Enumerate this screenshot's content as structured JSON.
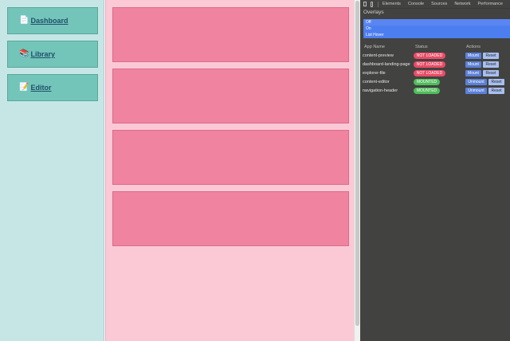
{
  "sidebar": {
    "items": [
      {
        "icon": "📄",
        "icon_name": "document-icon",
        "label": "Dashboard"
      },
      {
        "icon": "📚",
        "icon_name": "books-icon",
        "label": "Library"
      },
      {
        "icon": "📝",
        "icon_name": "memo-icon",
        "label": "Editor"
      }
    ]
  },
  "devtools": {
    "tabs": [
      "Elements",
      "Console",
      "Sources",
      "Network",
      "Performance"
    ],
    "overlays": {
      "title": "Overlays",
      "options": [
        "Off",
        "On",
        "List Hover"
      ],
      "selected": "Off"
    },
    "columns": {
      "name": "App Name",
      "status": "Status",
      "actions": "Actions"
    },
    "apps": [
      {
        "name": "content-preview",
        "status": "NOT LOADED",
        "action": "Mount",
        "reset": "Reset"
      },
      {
        "name": "dashboard-landing-page",
        "status": "NOT LOADED",
        "action": "Mount",
        "reset": "Reset"
      },
      {
        "name": "explorer-file",
        "status": "NOT LOADED",
        "action": "Mount",
        "reset": "Reset"
      },
      {
        "name": "content-editor",
        "status": "MOUNTED",
        "action": "Unmount",
        "reset": "Reset"
      },
      {
        "name": "navigation-header",
        "status": "MOUNTED",
        "action": "Unmount",
        "reset": "Reset"
      }
    ]
  },
  "colors": {
    "sidebar_bg": "#c6e6e5",
    "nav_item_bg": "#74c5b9",
    "content_bg": "#fbc9d6",
    "panel_bg": "#f0839f",
    "devtools_bg": "#424240",
    "overlay_selected": "#5a86f2",
    "not_loaded": "#e94c67",
    "mounted": "#4fbd5a"
  }
}
